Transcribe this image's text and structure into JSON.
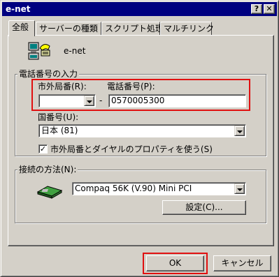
{
  "window": {
    "title": "e-net",
    "help_button": "?",
    "close_button": "✕"
  },
  "tabs": [
    {
      "label": "全般",
      "active": true
    },
    {
      "label": "サーバーの種類",
      "active": false
    },
    {
      "label": "スクリプト処理",
      "active": false
    },
    {
      "label": "マルチリンク",
      "active": false
    }
  ],
  "connection": {
    "name": "e-net",
    "icon": "dial-up-connection-icon"
  },
  "phone_group": {
    "label": "電話番号の入力",
    "area_code_label": "市外局番(R):",
    "area_code_value": "",
    "phone_label": "電話番号(P):",
    "dash": "-",
    "phone_value": "0570005300",
    "country_label": "国番号(U):",
    "country_value": "日本 (81)",
    "use_dialing_props_label": "市外局番とダイヤルのプロパティを使う(S)",
    "use_dialing_props_checked": true
  },
  "connect_group": {
    "label": "接続の方法(N):",
    "device_icon": "modem-icon",
    "device_value": "Compaq 56K (V.90) Mini PCI",
    "configure_label": "設定(C)..."
  },
  "footer": {
    "ok_label": "OK",
    "cancel_label": "キャンセル"
  },
  "colors": {
    "titlebar": "#000080",
    "highlight_box": "#e01010",
    "face": "#d4d0c8"
  }
}
